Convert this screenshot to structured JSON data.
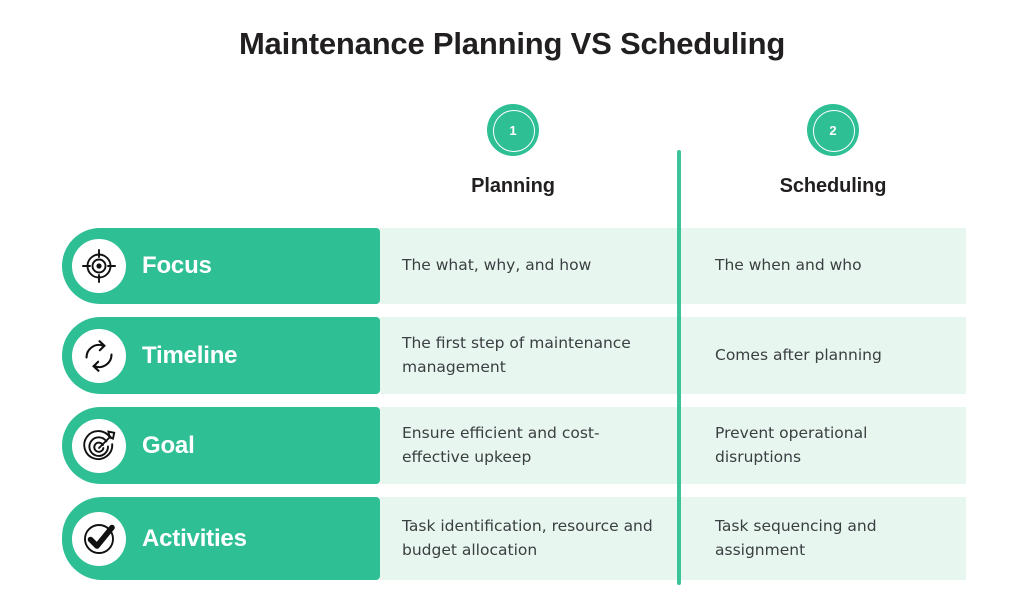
{
  "title": "Maintenance Planning VS Scheduling",
  "colors": {
    "accent_green": "#2fbf95",
    "divider_green": "#3bc49a",
    "cell_mint": "#e8f6f0",
    "text_dark": "#221f20",
    "body_text": "#3a3f41",
    "white": "#ffffff"
  },
  "columns": [
    {
      "number": "1",
      "label": "Planning"
    },
    {
      "number": "2",
      "label": "Scheduling"
    }
  ],
  "rows": [
    {
      "icon": "crosshair-target-icon",
      "label": "Focus",
      "planning": "The what, why, and how",
      "scheduling": "The when and who"
    },
    {
      "icon": "cycle-arrows-icon",
      "label": "Timeline",
      "planning": "The first step of maintenance management",
      "scheduling": "Comes after planning"
    },
    {
      "icon": "target-dart-icon",
      "label": "Goal",
      "planning": "Ensure efficient and cost-effective upkeep",
      "scheduling": "Prevent operational disruptions"
    },
    {
      "icon": "check-circle-icon",
      "label": "Activities",
      "planning": "Task identification, resource and budget allocation",
      "scheduling": "Task sequencing and assignment"
    }
  ]
}
